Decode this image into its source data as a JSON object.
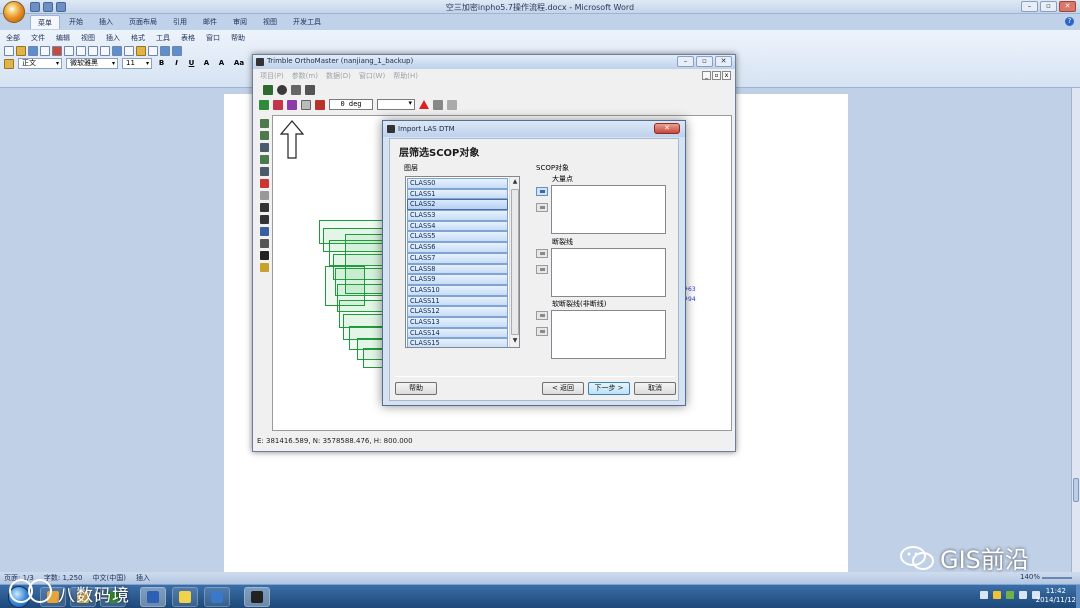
{
  "word": {
    "title": "空三加密inpho5.7操作流程.docx - Microsoft Word",
    "tabs": [
      "菜单",
      "开始",
      "插入",
      "页面布局",
      "引用",
      "邮件",
      "审阅",
      "视图",
      "开发工具"
    ],
    "menu_row": [
      "全部",
      "文件",
      "编辑",
      "视图",
      "插入",
      "格式",
      "工具",
      "表格",
      "窗口",
      "帮助"
    ],
    "style_value": "正文",
    "font_value": "微软雅黑",
    "size_value": "11",
    "format_buttons": [
      "B",
      "I",
      "U",
      "A",
      "A",
      "Aa"
    ],
    "status_page": "页面: 1/3",
    "status_words": "字数: 1,250",
    "status_lang": "中文(中国)",
    "status_insert": "插入",
    "zoom": "140%"
  },
  "orthomaster": {
    "title": "Trimble OrthoMaster (nanjiang_1_backup)",
    "menus": [
      "项目(P)",
      "参数(m)",
      "数据(D)",
      "窗口(W)",
      "帮助(H)"
    ],
    "angle_value": "0 deg",
    "status_coords": "E: 381416.589, N: 3578588.476, H: 800.000",
    "side_labels": [
      "#63",
      "#94"
    ]
  },
  "dialog": {
    "title": "Import LAS DTM",
    "heading": "层筛选SCOP对象",
    "layer_label": "图层",
    "scop_label": "SCOP对象",
    "layers": [
      "CLASS0",
      "CLASS1",
      "CLASS2",
      "CLASS3",
      "CLASS4",
      "CLASS5",
      "CLASS6",
      "CLASS7",
      "CLASS8",
      "CLASS9",
      "CLASS10",
      "CLASS11",
      "CLASS12",
      "CLASS13",
      "CLASS14",
      "CLASS15"
    ],
    "selected_layer": "CLASS2",
    "groups": [
      "大量点",
      "断裂线",
      "软断裂线(非断线)"
    ],
    "buttons": {
      "help": "帮助",
      "back": "< 返回",
      "next": "下一步 >",
      "cancel": "取消"
    }
  },
  "taskbar": {
    "time": "11:42",
    "date": "2014/11/12"
  },
  "watermark": {
    "text": "GIS前沿",
    "text2": "八数码境"
  },
  "colors": {
    "ribbon": "#c0d2ea",
    "dialog_frame": "#d5e2f1",
    "footprint": "#1f9a3a",
    "taskbar": "#1d4878"
  }
}
